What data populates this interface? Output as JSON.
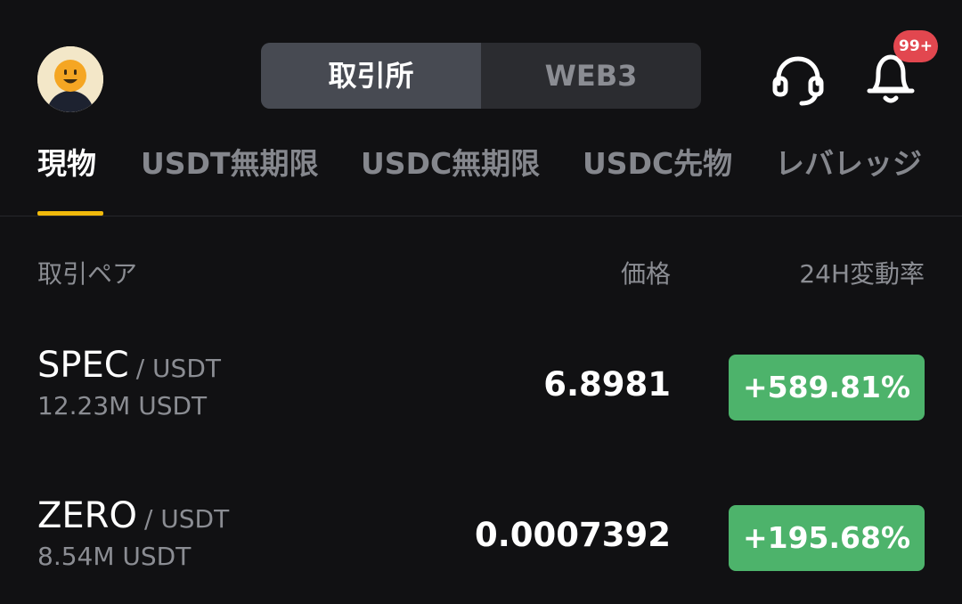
{
  "header": {
    "segment": {
      "active": "取引所",
      "other": "WEB3"
    },
    "notification_badge": "99+",
    "icons": {
      "avatar": "avatar",
      "support": "headset-icon",
      "notifications": "bell-icon"
    }
  },
  "tabs": [
    "現物",
    "USDT無期限",
    "USDC無期限",
    "USDC先物",
    "レバレッジ"
  ],
  "columns": {
    "pair": "取引ペア",
    "price": "価格",
    "change": "24H変動率"
  },
  "rows": [
    {
      "base": "SPEC",
      "quote": "/ USDT",
      "volume": "12.23M USDT",
      "price": "6.8981",
      "change": "+589.81%"
    },
    {
      "base": "ZERO",
      "quote": "/ USDT",
      "volume": "8.54M USDT",
      "price": "0.0007392",
      "change": "+195.68%"
    }
  ],
  "colors": {
    "background": "#111113",
    "accent": "#f0b90b",
    "positive": "#4db36b",
    "badge": "#e2474f"
  }
}
